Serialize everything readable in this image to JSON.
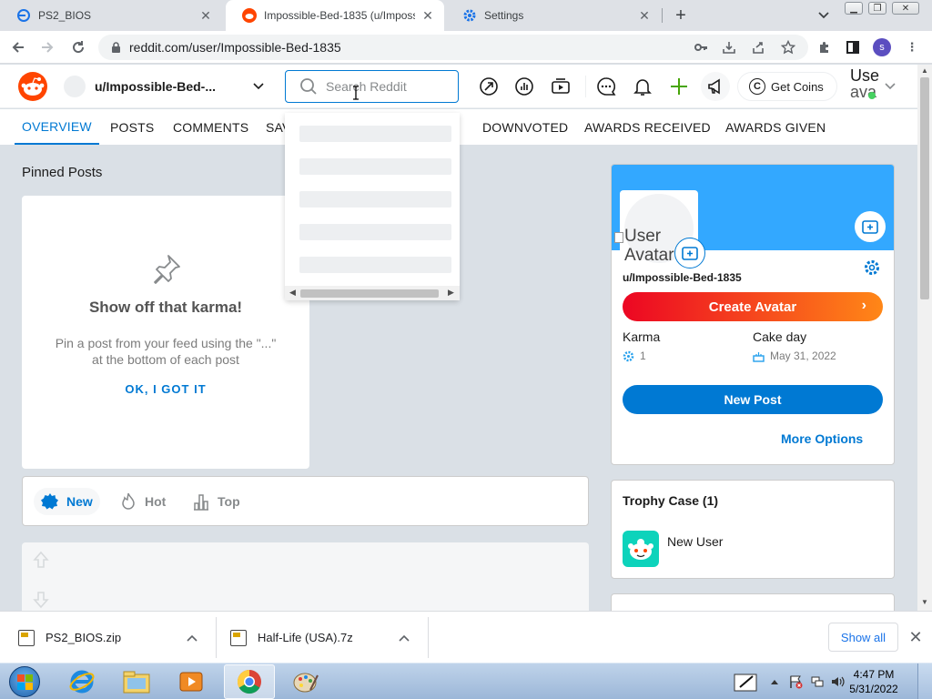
{
  "browser": {
    "tabs": [
      {
        "title": "PS2_BIOS",
        "active": false
      },
      {
        "title": "Impossible-Bed-1835 (u/Impossi",
        "active": true
      },
      {
        "title": "Settings",
        "active": false
      }
    ],
    "url": "reddit.com/user/Impossible-Bed-1835",
    "profile_initial": "s"
  },
  "reddit_header": {
    "community_label": "u/Impossible-Bed-...",
    "search_placeholder": "Search Reddit",
    "coins_label": "Get Coins",
    "user_avatar_alt_line1": "Use",
    "user_avatar_alt_line2": "ava"
  },
  "profile_tabs": [
    {
      "label": "OVERVIEW",
      "active": true
    },
    {
      "label": "POSTS",
      "active": false
    },
    {
      "label": "COMMENTS",
      "active": false
    },
    {
      "label": "SAV",
      "active": false
    },
    {
      "label": "DOWNVOTED",
      "active": false
    },
    {
      "label": "AWARDS RECEIVED",
      "active": false
    },
    {
      "label": "AWARDS GIVEN",
      "active": false
    }
  ],
  "pinned": {
    "section_title": "Pinned Posts",
    "heading": "Show off that karma!",
    "body": "Pin a post from your feed using the \"...\" at the bottom of each post",
    "ok_label": "OK, I GOT IT"
  },
  "sort": {
    "new_label": "New",
    "hot_label": "Hot",
    "top_label": "Top"
  },
  "profile_card": {
    "avatar_alt": "User Avatar",
    "username": "u/Impossible-Bed-1835",
    "create_avatar_label": "Create Avatar",
    "karma_label": "Karma",
    "karma_value": "1",
    "cakeday_label": "Cake day",
    "cakeday_value": "May 31, 2022",
    "new_post_label": "New Post",
    "more_options_label": "More Options"
  },
  "trophy_case": {
    "title": "Trophy Case (1)",
    "trophies": [
      {
        "name": "New User"
      }
    ]
  },
  "downloads": {
    "items": [
      {
        "name": "PS2_BIOS.zip"
      },
      {
        "name": "Half-Life (USA).7z"
      }
    ],
    "show_all_label": "Show all"
  },
  "taskbar": {
    "time": "4:47 PM",
    "date": "5/31/2022"
  },
  "colors": {
    "reddit_blue": "#0079d3",
    "reddit_orange": "#ff4500",
    "banner": "#33a8ff",
    "create_avatar_start": "#ec0623",
    "create_avatar_end": "#ff8717"
  }
}
